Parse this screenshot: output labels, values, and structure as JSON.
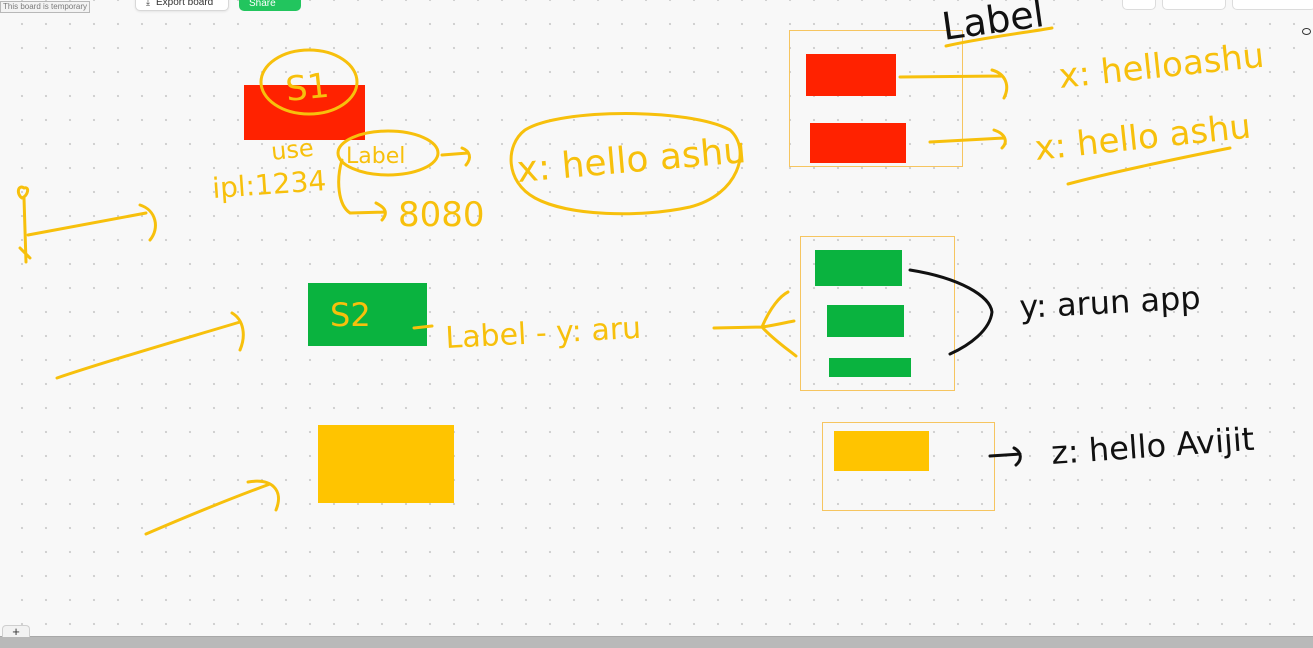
{
  "toolbar": {
    "temp_notice": "This board is temporary",
    "export_label": "Export board",
    "share_label": "Share"
  },
  "colors": {
    "red": "#ff2200",
    "green": "#0ab33f",
    "yellow": "#ffc400",
    "marker_yellow": "#f7c00c",
    "frame_border": "#f6c560",
    "ink_black": "#111111"
  },
  "annotations": {
    "s1": "S1",
    "use": "use",
    "label_small": "Label",
    "port_mapping": "ipl:1234",
    "port": "8080",
    "bubble": "x: hello ashu",
    "s2": "S2",
    "label_line": "Label - y: aru",
    "label_header": "Label",
    "x_first": "x: helloashu",
    "x_second": "x: hello ashu",
    "y_value": "y: arun app",
    "z_value": "z: hello Avijit"
  },
  "bottom": {
    "add_label": "+"
  }
}
